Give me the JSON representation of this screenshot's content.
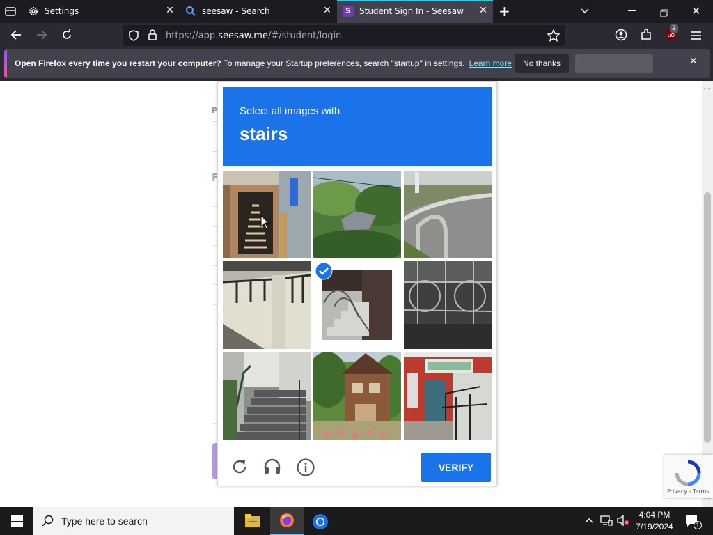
{
  "tabs": [
    {
      "label": "Settings",
      "icon": "gear-icon"
    },
    {
      "label": "seesaw - Search",
      "icon": "search-icon"
    },
    {
      "label": "Student Sign In - Seesaw",
      "icon": "seesaw-icon",
      "active": true
    }
  ],
  "url": {
    "prefix": "https://app.",
    "domain": "seesaw.me",
    "suffix": "/#/student/login"
  },
  "notification": {
    "bold": "Open Firefox every time you restart your computer?",
    "text": " To manage your Startup preferences, search \"startup\" in settings.",
    "learn_more": "Learn more",
    "no_thanks": "No thanks"
  },
  "extensions_badge": "2",
  "captcha": {
    "prompt": "Select all images with",
    "target": "stairs",
    "verify_label": "VERIFY",
    "tiles": [
      {
        "name": "tile-1",
        "selected": false
      },
      {
        "name": "tile-2",
        "selected": false
      },
      {
        "name": "tile-3",
        "selected": false
      },
      {
        "name": "tile-4",
        "selected": false
      },
      {
        "name": "tile-5",
        "selected": true
      },
      {
        "name": "tile-6",
        "selected": false
      },
      {
        "name": "tile-7",
        "selected": false
      },
      {
        "name": "tile-8",
        "selected": false
      },
      {
        "name": "tile-9",
        "selected": false
      }
    ]
  },
  "recaptcha_footer": "Privacy - Terms",
  "taskbar": {
    "search_placeholder": "Type here to search",
    "time": "4:04 PM",
    "date": "7/19/2024",
    "notifications_count": "1"
  },
  "colors": {
    "accent": "#1a73e8",
    "tab_highlight": "#00ddff"
  }
}
